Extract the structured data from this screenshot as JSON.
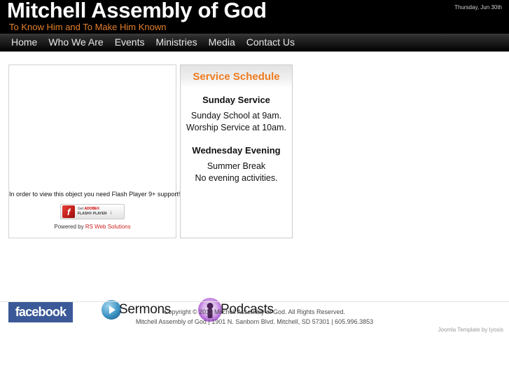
{
  "header": {
    "site_title": "Mitchell Assembly of God",
    "tagline": "To Know Him and To Make Him Known",
    "date": "Thursday, Jun 30th"
  },
  "nav": {
    "items": [
      {
        "label": "Home"
      },
      {
        "label": "Who We Are"
      },
      {
        "label": "Events"
      },
      {
        "label": "Ministries"
      },
      {
        "label": "Media"
      },
      {
        "label": "Contact Us"
      }
    ]
  },
  "media_box": {
    "flash_message": "In order to view this object you need Flash Player 9+ support!",
    "adobe_button": {
      "icon_glyph": "f",
      "line1_prefix": "Get ",
      "line1_brand": "ADOBE®",
      "line2": "FLASH® PLAYER",
      "download_arrow": "↓"
    },
    "powered_by_prefix": "Powered by ",
    "powered_by_link": "RS Web Solutions"
  },
  "service_schedule": {
    "title": "Service Schedule",
    "sunday": {
      "heading": "Sunday Service",
      "lines": [
        "Sunday School at 9am.",
        "Worship Service at 10am."
      ]
    },
    "wednesday": {
      "heading": "Wednesday Evening",
      "lines": [
        "Summer Break",
        "No evening activities."
      ]
    }
  },
  "social": {
    "facebook_label": "facebook",
    "sermons_label": "Sermons",
    "podcasts_label": "Podcasts"
  },
  "footer": {
    "copyright": "Copyright © 2011 Mitchell Assembly of God. All Rights Reserved.",
    "address": "Mitchell Assembly of God | 1901 N. Sanborn Blvd. Mitchell, SD 57301 | 605.996.3853",
    "template_credit": "Joomla Template by Iyosis"
  },
  "colors": {
    "header_bg": "#000000",
    "tagline": "#e2802c",
    "accent_orange": "#f07c1f",
    "facebook_blue": "#3b5998",
    "link_red": "#cc2222"
  }
}
